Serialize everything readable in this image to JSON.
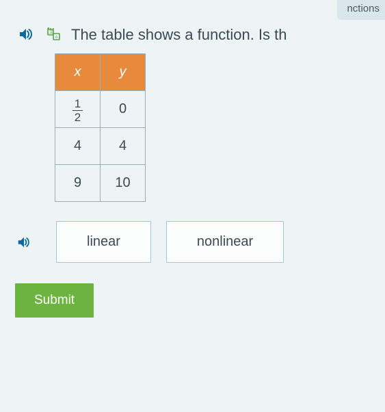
{
  "topbar_fragment": "nctions",
  "question": {
    "text": "The table shows a function. Is th"
  },
  "chart_data": {
    "type": "table",
    "columns": [
      "x",
      "y"
    ],
    "rows": [
      {
        "x": "1/2",
        "y": "0"
      },
      {
        "x": "4",
        "y": "4"
      },
      {
        "x": "9",
        "y": "10"
      }
    ]
  },
  "choices": {
    "linear": "linear",
    "nonlinear": "nonlinear"
  },
  "buttons": {
    "submit": "Submit"
  },
  "icons": {
    "audio": "audio-icon",
    "translate": "translate-icon"
  }
}
